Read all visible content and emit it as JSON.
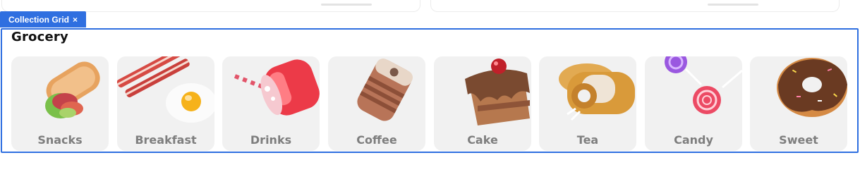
{
  "builder": {
    "chip_label": "Collection Grid",
    "chip_close": "×"
  },
  "section": {
    "title": "Grocery"
  },
  "categories": [
    {
      "label": "Snacks",
      "icon": "wrap-icon"
    },
    {
      "label": "Breakfast",
      "icon": "bacon-egg-icon"
    },
    {
      "label": "Drinks",
      "icon": "soda-cup-icon"
    },
    {
      "label": "Coffee",
      "icon": "coffee-cup-icon"
    },
    {
      "label": "Cake",
      "icon": "cake-icon"
    },
    {
      "label": "Tea",
      "icon": "tea-mug-icon"
    },
    {
      "label": "Candy",
      "icon": "lollipop-icon"
    },
    {
      "label": "Sweet",
      "icon": "donut-icon"
    }
  ],
  "colors": {
    "accent": "#2f6fe0",
    "card_bg": "#f1f1f1",
    "label": "#7e7e7e"
  }
}
